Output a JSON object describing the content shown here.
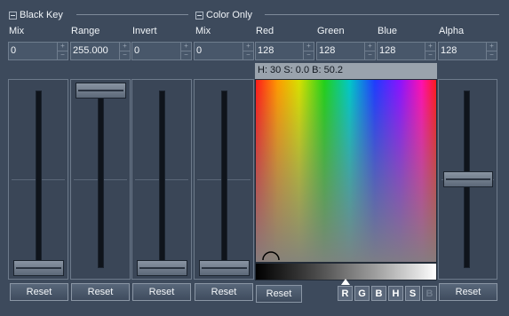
{
  "black_key": {
    "title": "Black Key",
    "mix": {
      "label": "Mix",
      "value": "0",
      "slider_fraction": 0.0
    },
    "range": {
      "label": "Range",
      "value": "255.000",
      "slider_fraction": 1.0
    },
    "invert": {
      "label": "Invert",
      "value": "0",
      "slider_fraction": 0.0
    }
  },
  "color_only": {
    "title": "Color Only",
    "mix": {
      "label": "Mix",
      "value": "0",
      "slider_fraction": 0.0
    },
    "red": {
      "label": "Red",
      "value": "128"
    },
    "green": {
      "label": "Green",
      "value": "128"
    },
    "blue": {
      "label": "Blue",
      "value": "128"
    },
    "alpha": {
      "label": "Alpha",
      "value": "128",
      "slider_fraction": 0.5
    },
    "hsb_readout": "H: 30  S: 0.0  B: 50.2",
    "mode_buttons": [
      "R",
      "G",
      "B",
      "H",
      "S",
      "B"
    ]
  },
  "buttons": {
    "reset_label": "Reset"
  },
  "icons": {
    "collapse": "collapse-minus-icon",
    "spin_up": "spin-up-icon",
    "spin_down": "spin-down-icon",
    "ramp_marker": "triangle-marker-icon"
  },
  "spin_glyphs": {
    "up": "+",
    "down": "−"
  },
  "colors": {
    "background": "#3d4a5c",
    "track": "#0f141b",
    "readout_bg": "#9aa3ad"
  }
}
